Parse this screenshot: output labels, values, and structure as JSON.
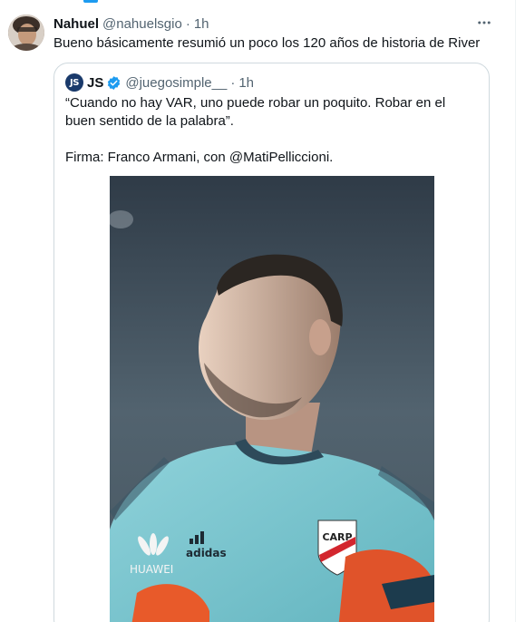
{
  "tweet": {
    "author_name": "Nahuel",
    "author_handle": "@nahuelsgio",
    "separator": "·",
    "time": "1h",
    "text": "Bueno básicamente resumió un poco los 120 años de historia de River",
    "more_icon": "more-horizontal-icon"
  },
  "quote": {
    "avatar_text": "JS",
    "author_name": "JS",
    "verified_icon": "verified-badge-icon",
    "author_handle": "@juegosimple__",
    "separator": "·",
    "time": "1h",
    "text_line1": "“Cuando no hay VAR, uno puede robar un poquito. Robar en el buen sentido de la palabra”.",
    "text_line2": "Firma: Franco Armani, con @MatiPelliccioni."
  },
  "colors": {
    "accent": "#1d9bf0",
    "text_primary": "#0f1419",
    "text_secondary": "#536471",
    "border": "#cfd9de",
    "jersey": "#7fc6cf"
  }
}
